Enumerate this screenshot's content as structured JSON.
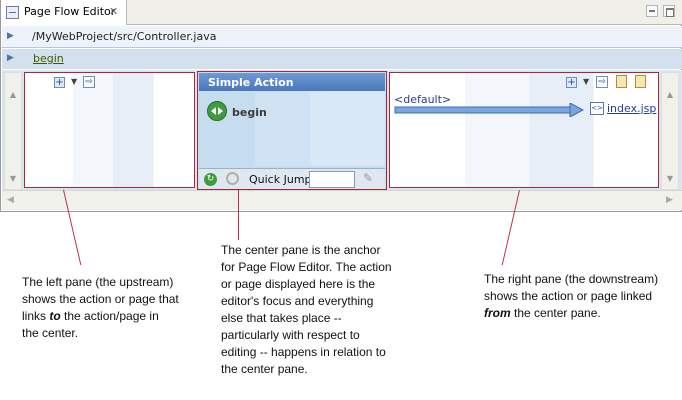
{
  "tab": {
    "title": "Page Flow Editor",
    "close": "✕"
  },
  "path": {
    "text": "/MyWebProject/src/Controller.java"
  },
  "flow": {
    "current": "begin"
  },
  "center": {
    "header": "Simple Action",
    "action": "begin",
    "footer": {
      "quick_jump_label": "Quick Jump",
      "quick_jump_value": ""
    }
  },
  "right": {
    "default_label": "<default>",
    "target": "index.jsp"
  },
  "annotations": {
    "left": {
      "line1": "The left pane (the upstream)",
      "line2": "shows the action or page that",
      "line3_prefix": "links ",
      "line3_em": "to",
      "line3_suffix": " the action/page in",
      "line4": "the center."
    },
    "center": {
      "line1": "The center pane is the anchor",
      "line2": "for Page Flow Editor. The action",
      "line3": "or page displayed here is the",
      "line4": "editor's focus and everything",
      "line5": "else that takes place --",
      "line6": "particularly with respect to",
      "line7": "editing -- happens in relation to",
      "line8": "the center pane."
    },
    "right": {
      "line1": "The right pane (the downstream)",
      "line2": "shows the action or page linked",
      "line3_em": "from",
      "line3_suffix": " the center pane."
    }
  },
  "colors": {
    "pane_border": "#a32a3a",
    "header_blue": "#4a78bc",
    "link_blue": "#1f3f9a"
  }
}
